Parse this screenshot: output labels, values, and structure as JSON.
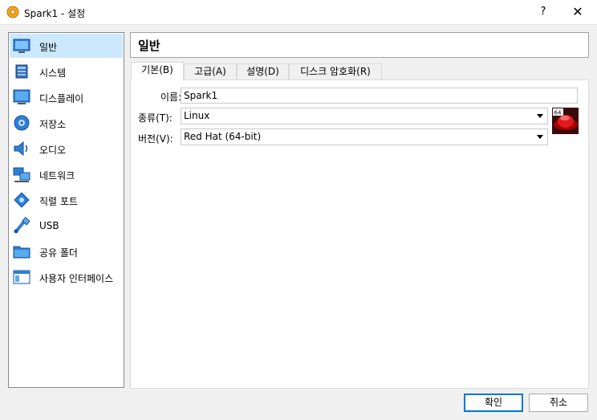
{
  "window": {
    "title": "Spark1 - 설정",
    "help_label": "?",
    "close_label": "✕"
  },
  "sidebar": {
    "items": [
      {
        "label": "일반",
        "icon": "general-icon",
        "selected": true
      },
      {
        "label": "시스템",
        "icon": "system-icon"
      },
      {
        "label": "디스플레이",
        "icon": "display-icon"
      },
      {
        "label": "저장소",
        "icon": "storage-icon"
      },
      {
        "label": "오디오",
        "icon": "audio-icon"
      },
      {
        "label": "네트워크",
        "icon": "network-icon"
      },
      {
        "label": "직렬 포트",
        "icon": "serial-port-icon"
      },
      {
        "label": "USB",
        "icon": "usb-icon"
      },
      {
        "label": "공유 폴더",
        "icon": "shared-folder-icon"
      },
      {
        "label": "사용자 인터페이스",
        "icon": "user-interface-icon"
      }
    ]
  },
  "main": {
    "section_title": "일반",
    "tabs": [
      {
        "label": "기본(B)",
        "active": true
      },
      {
        "label": "고급(A)"
      },
      {
        "label": "설명(D)"
      },
      {
        "label": "디스크 암호화(R)"
      }
    ],
    "form": {
      "name_label": "이름:",
      "name_value": "Spark1",
      "type_label": "종류(T):",
      "type_value": "Linux",
      "version_label": "버전(V):",
      "version_value": "Red Hat (64-bit)",
      "os_badge": "64"
    }
  },
  "buttons": {
    "ok": "확인",
    "cancel": "취소"
  },
  "colors": {
    "selection": "#cce8ff",
    "accent": "#0078d7"
  }
}
